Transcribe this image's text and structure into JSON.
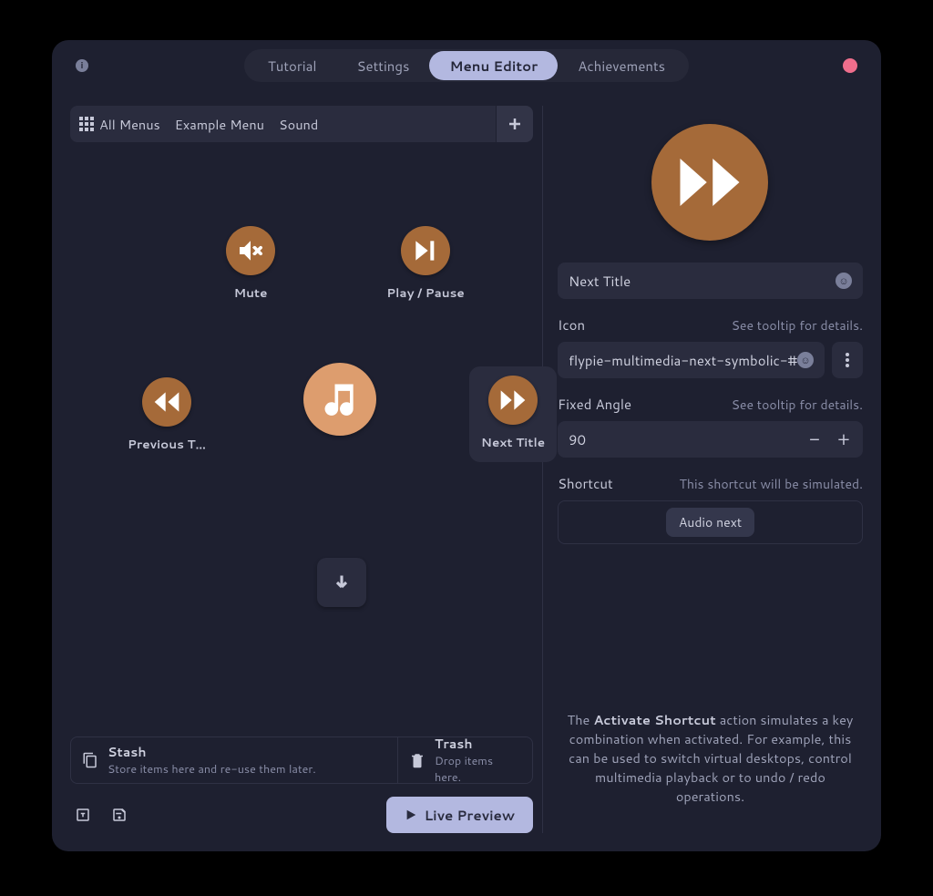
{
  "header": {
    "tabs": [
      "Tutorial",
      "Settings",
      "Menu Editor",
      "Achievements"
    ],
    "active_tab": "Menu Editor"
  },
  "breadcrumb": {
    "items": [
      "All Menus",
      "Example Menu",
      "Sound"
    ]
  },
  "canvas": {
    "nodes": {
      "mute": {
        "label": "Mute"
      },
      "playpause": {
        "label": "Play / Pause"
      },
      "prev": {
        "label": "Previous T…"
      },
      "next": {
        "label": "Next Title"
      }
    }
  },
  "stash": {
    "title": "Stash",
    "subtitle": "Store items here and re-use them later."
  },
  "trash": {
    "title": "Trash",
    "subtitle": "Drop items here."
  },
  "preview_label": "Live Preview",
  "right": {
    "name_value": "Next Title",
    "icon_label": "Icon",
    "icon_hint": "See tooltip for details.",
    "icon_value": "flypie-multimedia-next-symbolic-#",
    "angle_label": "Fixed Angle",
    "angle_hint": "See tooltip for details.",
    "angle_value": "90",
    "shortcut_label": "Shortcut",
    "shortcut_hint": "This shortcut will be simulated.",
    "shortcut_chip": "Audio next",
    "desc_prefix": "The ",
    "desc_bold": "Activate Shortcut",
    "desc_rest": " action simulates a key combination when activated. For example, this can be used to switch virtual desktops, control multimedia playback or to undo / redo operations."
  }
}
